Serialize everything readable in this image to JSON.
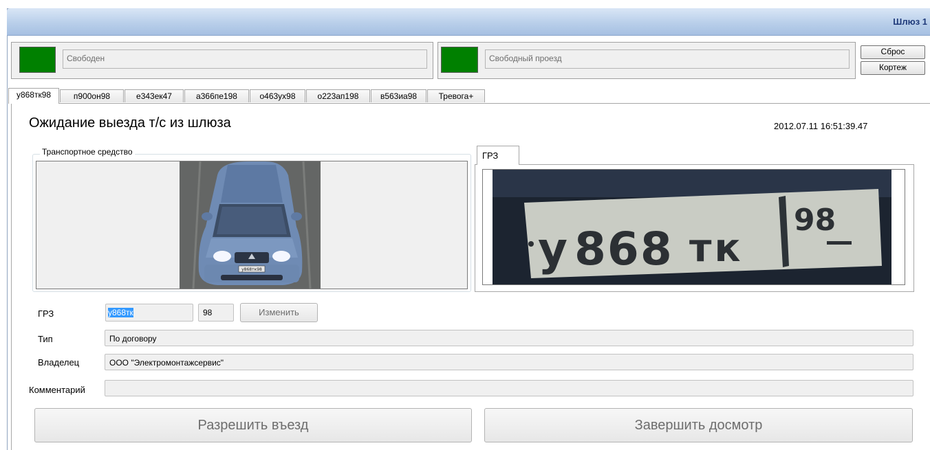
{
  "window": {
    "title": "Шлюз 1"
  },
  "status": {
    "left": {
      "text": "Свободен",
      "color": "#008000"
    },
    "right": {
      "text": "Свободный проезд",
      "color": "#008000"
    }
  },
  "side_buttons": {
    "reset": "Сброс",
    "cortege": "Кортеж"
  },
  "tabs": [
    {
      "label": "у868тк98",
      "active": true
    },
    {
      "label": "п900он98"
    },
    {
      "label": "е343ек47"
    },
    {
      "label": "а366пе198"
    },
    {
      "label": "о463ух98"
    },
    {
      "label": "о223ап198"
    },
    {
      "label": "в563иа98"
    },
    {
      "label": "Тревога+"
    }
  ],
  "main": {
    "heading": "Ожидание выезда т/с из шлюза",
    "timestamp": "2012.07.11 16:51:39.47",
    "vehicle_group_label": "Транспортное средство",
    "plate_tab_label": "ГРЗ",
    "plate_image_text": {
      "letter1": "у",
      "digits": "868",
      "letters": "тк",
      "region": "98"
    },
    "car_plate_small": "у868тк98"
  },
  "form": {
    "grz_label": "ГРЗ",
    "grz_value": "у868тк",
    "region_value": "98",
    "change_button": "Изменить",
    "type_label": "Тип",
    "type_value": "По договору",
    "owner_label": "Владелец",
    "owner_value": "ООО \"Электромонтажсервис\"",
    "comment_label": "Комментарий",
    "comment_value": ""
  },
  "actions": {
    "allow": "Разрешить въезд",
    "finish": "Завершить досмотр"
  }
}
